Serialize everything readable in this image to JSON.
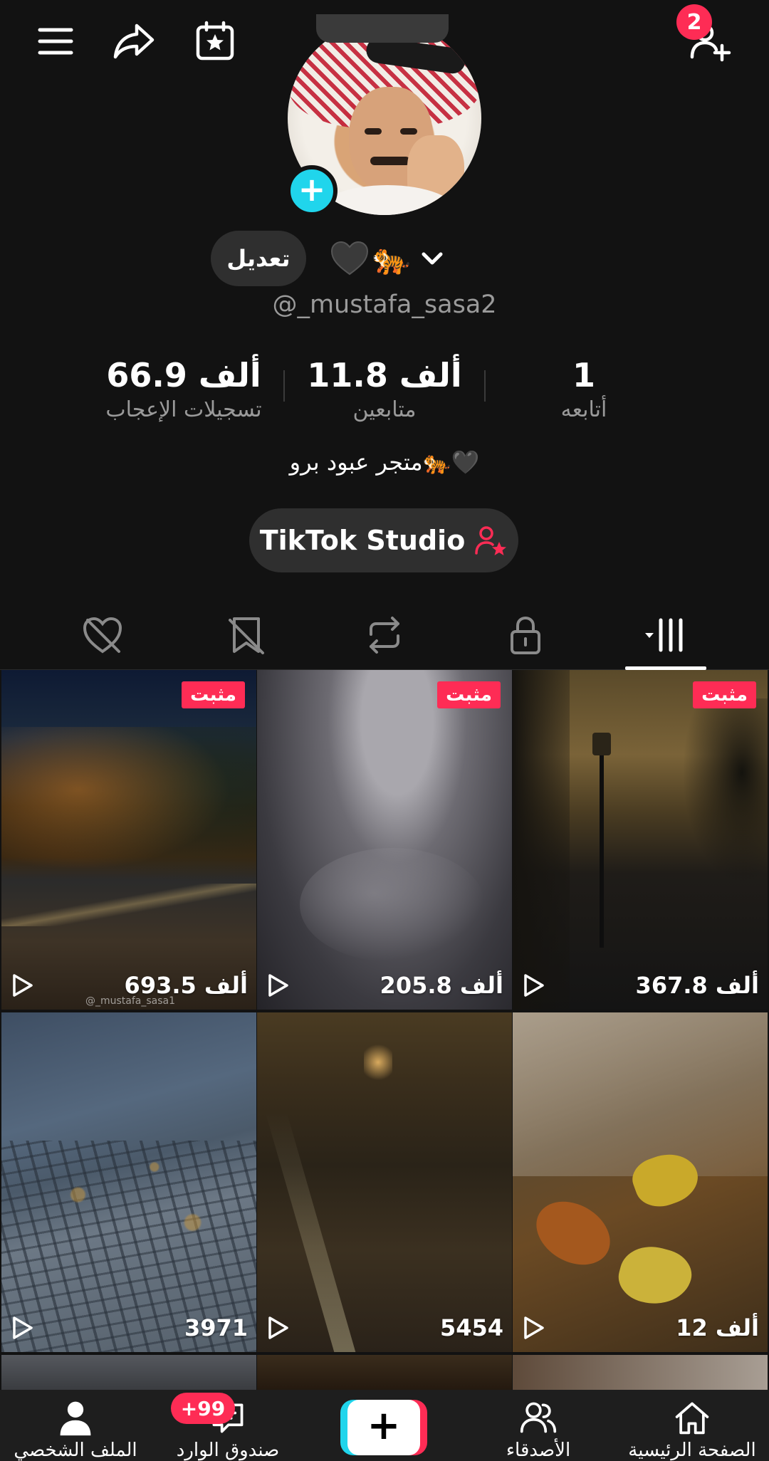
{
  "profile": {
    "display_name_emoji": "🐅",
    "username": "@_mustafa_sasa2",
    "edit_label": "تعديل",
    "bio": "متجر عبود برو🐅🖤",
    "studio_label": "TikTok Studio"
  },
  "header": {
    "add_friend_badge": "2"
  },
  "stats": [
    {
      "value": "66.9 ألف",
      "label": "تسجيلات الإعجاب"
    },
    {
      "value": "11.8 ألف",
      "label": "متابعين"
    },
    {
      "value": "1",
      "label": "أتابعه"
    }
  ],
  "videos": [
    {
      "views": "693.5 ألف",
      "pinned": true,
      "pinned_label": "مثبت",
      "watermark": "@_mustafa_sasa1"
    },
    {
      "views": "205.8 ألف",
      "pinned": true,
      "pinned_label": "مثبت"
    },
    {
      "views": "367.8 ألف",
      "pinned": true,
      "pinned_label": "مثبت"
    },
    {
      "views": "3971",
      "pinned": false
    },
    {
      "views": "5454",
      "pinned": false
    },
    {
      "views": "12 ألف",
      "pinned": false
    }
  ],
  "bottom_nav": {
    "profile_label": "الملف الشخصي",
    "inbox_label": "صندوق الوارد",
    "inbox_badge": "+99",
    "friends_label": "الأصدقاء",
    "home_label": "الصفحة الرئيسية"
  },
  "colors": {
    "background": "#121212",
    "accent_red": "#fe2c55",
    "accent_cyan": "#20d5ec"
  }
}
